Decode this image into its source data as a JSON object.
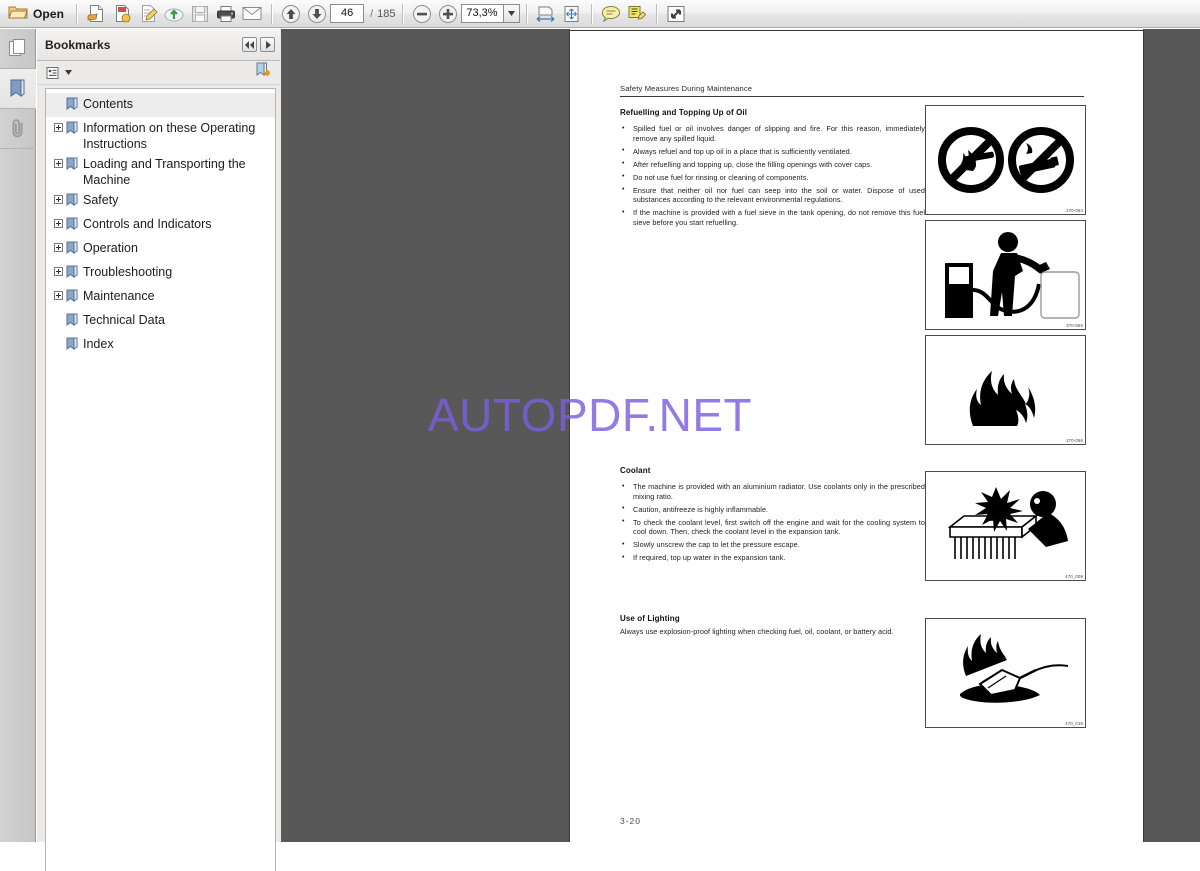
{
  "app": {
    "toolbar": {
      "open_label": "Open",
      "page_current": "46",
      "page_separator": "/",
      "page_total": "185",
      "zoom_value": "73,3%",
      "buttons": [
        {
          "name": "open-folder-icon",
          "label": "Open"
        },
        {
          "name": "create-pdf-icon",
          "label": "Create PDF"
        },
        {
          "name": "combine-files-icon",
          "label": "Combine Files"
        },
        {
          "name": "edit-pdf-icon",
          "label": "Edit PDF"
        },
        {
          "name": "upload-cloud-icon",
          "label": "Send to Cloud"
        },
        {
          "name": "save-icon",
          "label": "Save"
        },
        {
          "name": "print-icon",
          "label": "Print"
        },
        {
          "name": "email-icon",
          "label": "Email"
        },
        {
          "name": "previous-page-icon",
          "label": "Previous Page"
        },
        {
          "name": "next-page-icon",
          "label": "Next Page"
        },
        {
          "name": "zoom-out-icon",
          "label": "Zoom Out"
        },
        {
          "name": "zoom-in-icon",
          "label": "Zoom In"
        },
        {
          "name": "fit-width-icon",
          "label": "Fit Width"
        },
        {
          "name": "fit-page-icon",
          "label": "Fit Page"
        },
        {
          "name": "comment-icon",
          "label": "Add Sticky Note"
        },
        {
          "name": "highlight-text-icon",
          "label": "Highlight Text"
        },
        {
          "name": "fullscreen-icon",
          "label": "Full Screen"
        }
      ]
    },
    "rail": {
      "items": [
        {
          "name": "page-thumbnails-icon",
          "label": "Page Thumbnails",
          "active": false
        },
        {
          "name": "bookmarks-icon",
          "label": "Bookmarks",
          "active": true
        },
        {
          "name": "attachments-icon",
          "label": "Attachments",
          "active": false
        }
      ]
    },
    "bookmarks_panel": {
      "title": "Bookmarks",
      "nav_prev": "◀◀",
      "nav_next": "▶",
      "options_label": "Options",
      "expand_label": "Expand Current Bookmark",
      "items": [
        {
          "label": "Contents",
          "expandable": false,
          "selected": true
        },
        {
          "label": "Information on these Operating Instructions",
          "expandable": true,
          "selected": false
        },
        {
          "label": "Loading and Transporting the Machine",
          "expandable": true,
          "selected": false
        },
        {
          "label": "Safety",
          "expandable": true,
          "selected": false
        },
        {
          "label": "Controls and Indicators",
          "expandable": true,
          "selected": false
        },
        {
          "label": "Operation",
          "expandable": true,
          "selected": false
        },
        {
          "label": "Troubleshooting",
          "expandable": true,
          "selected": false
        },
        {
          "label": "Maintenance",
          "expandable": true,
          "selected": false
        },
        {
          "label": "Technical Data",
          "expandable": false,
          "selected": false
        },
        {
          "label": "Index",
          "expandable": false,
          "selected": false
        }
      ]
    }
  },
  "document": {
    "running_head": "Safety Measures During Maintenance",
    "folio": "3-20",
    "watermark": "AUTOPDF.NET",
    "sections": [
      {
        "heading": "Refuelling and Topping Up of Oil",
        "bullets": [
          "Spilled fuel or oil involves danger of slipping and fire. For this reason, immediately remove any spilled liquid.",
          "Always refuel and top up oil in a place that is sufficiently ventilated.",
          "After refuelling and topping up, close the filling openings with cover caps.",
          "Do not use fuel for rinsing or cleaning of components.",
          "Ensure that neither oil nor fuel can seep into the soil or water. Dispose of used substances according to the relevant environmental regulations.",
          "If the machine is provided with a fuel sieve in the tank opening, do not remove this fuel sieve before you start refuelling."
        ]
      },
      {
        "heading": "Coolant",
        "bullets": [
          "The machine is provided with an aluminium radiator. Use coolants only in the prescribed mixing ratio.",
          "Caution, antifreeze is highly inflammable.",
          "To check the coolant level, first switch off the engine and wait for the cooling system to cool down. Then, check the coolant level in the expansion tank.",
          "Slowly unscrew the cap to let the pressure escape.",
          "If required, top up water in the expansion tank."
        ]
      },
      {
        "heading": "Use of Lighting",
        "paragraph": "Always use explosion-proof lighting when checking fuel, oil, coolant, or battery acid."
      }
    ],
    "figures": [
      {
        "name": "no-open-flame-no-smoking-figure",
        "code": "270-064"
      },
      {
        "name": "refuelling-figure",
        "code": "370-955"
      },
      {
        "name": "fire-flame-figure",
        "code": "270-056"
      },
      {
        "name": "radiator-steam-burn-figure",
        "code": "470_009"
      },
      {
        "name": "explosion-proof-lamp-figure",
        "code": "470_016"
      }
    ]
  },
  "colors": {
    "toolbar_bg": "#ededed",
    "doc_backdrop": "#585858",
    "page_bg": "#ffffff",
    "watermark": "#7c5fe0",
    "bookmark_icon": "#7e9cc4",
    "selection": "#ededed"
  }
}
